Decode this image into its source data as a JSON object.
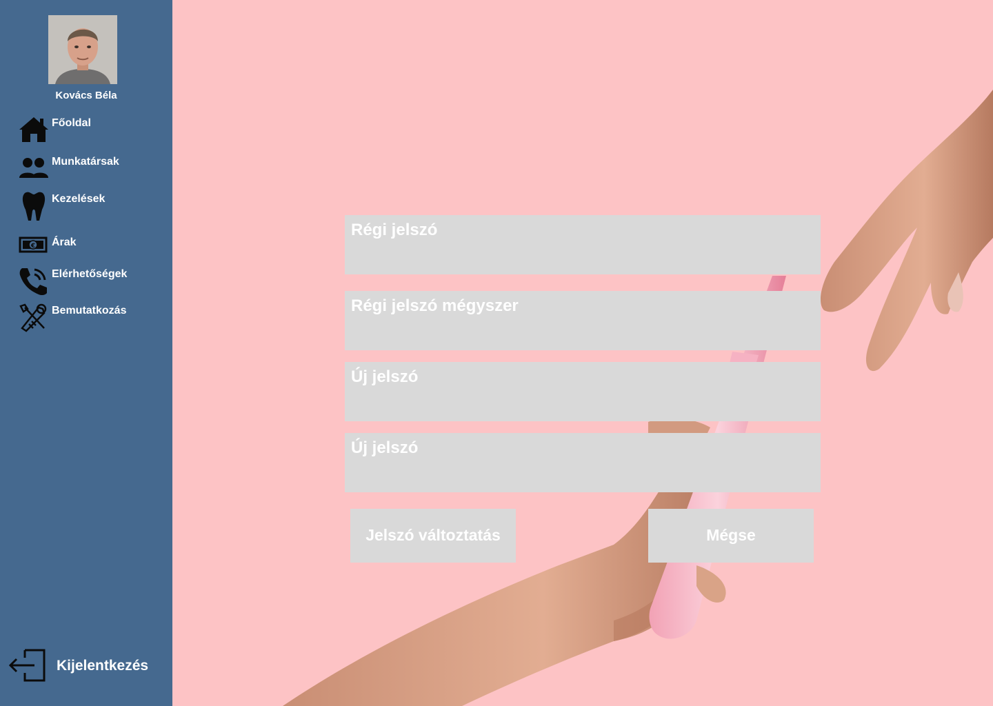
{
  "user": {
    "name": "Kovács Béla"
  },
  "nav": {
    "items": [
      {
        "label": "Főoldal",
        "icon": "home-icon"
      },
      {
        "label": "Munkatársak",
        "icon": "people-icon"
      },
      {
        "label": "Kezelések",
        "icon": "tooth-icon"
      },
      {
        "label": "Árak",
        "icon": "euro-banknote-icon"
      },
      {
        "label": "Elérhetőségek",
        "icon": "phone-icon"
      },
      {
        "label": "Bemutatkozás",
        "icon": "tools-icon"
      }
    ],
    "logout_label": "Kijelentkezés",
    "logout_icon": "logout-icon"
  },
  "form": {
    "fields": [
      {
        "placeholder": "Régi jelszó"
      },
      {
        "placeholder": "Régi jelszó mégyszer"
      },
      {
        "placeholder": "Új jelszó"
      },
      {
        "placeholder": "Új jelszó"
      }
    ],
    "submit_label": "Jelszó változtatás",
    "cancel_label": "Mégse"
  },
  "colors": {
    "sidebar": "#45698f",
    "background": "#fdc3c5",
    "field": "#d9d9d9",
    "text": "#ffffff"
  }
}
